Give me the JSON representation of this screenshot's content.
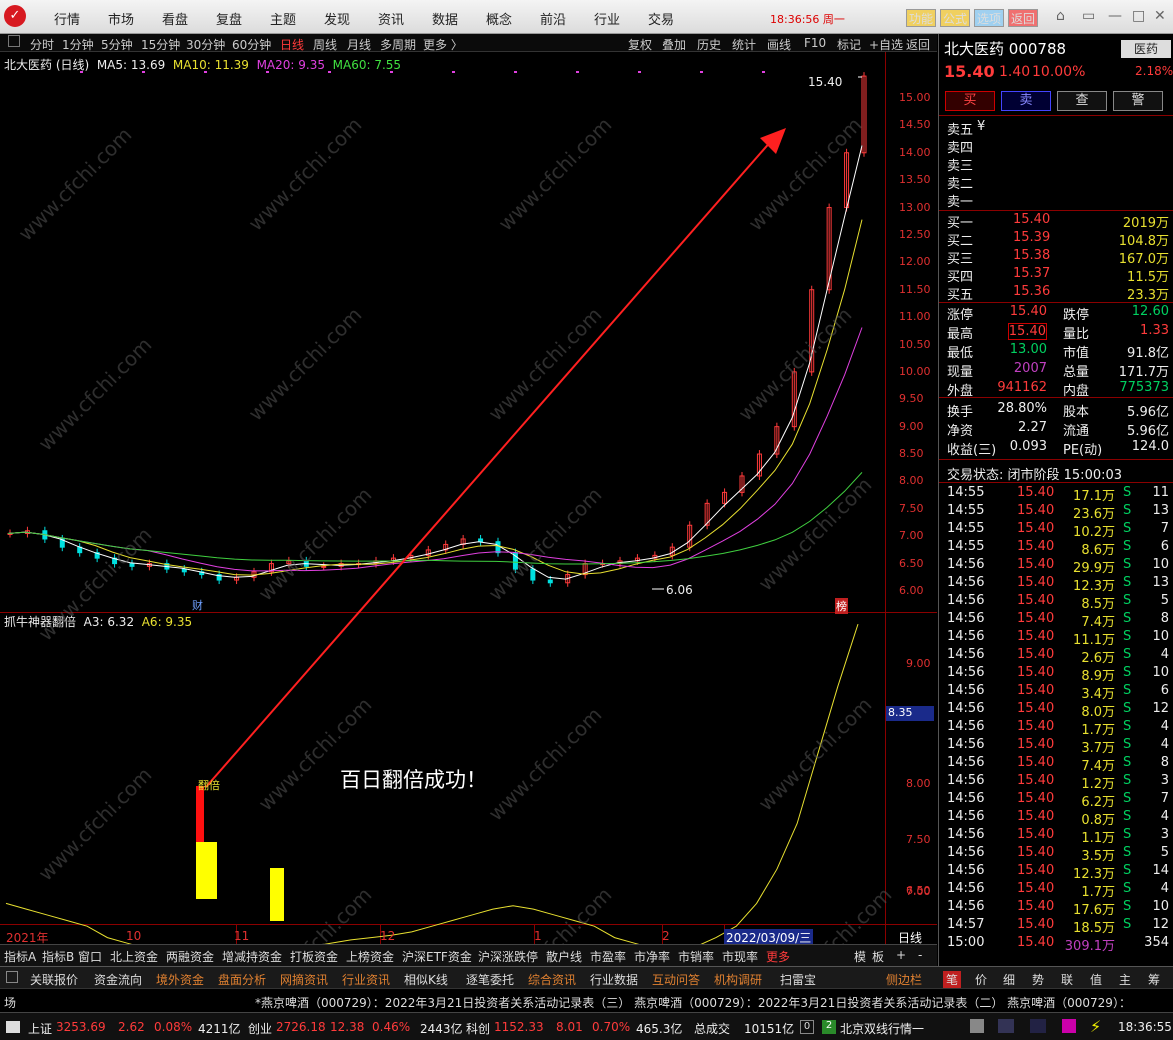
{
  "menu": {
    "items": [
      "行情",
      "市场",
      "看盘",
      "复盘",
      "主题",
      "发现",
      "资讯",
      "数据",
      "概念",
      "前沿",
      "行业",
      "交易"
    ],
    "time": "18:36:56",
    "weekday": "周一",
    "buttons": [
      "功能",
      "公式",
      "选项",
      "返回"
    ]
  },
  "period": {
    "items": [
      "分时",
      "1分钟",
      "5分钟",
      "15分钟",
      "30分钟",
      "60分钟",
      "日线",
      "周线",
      "月线",
      "多周期",
      "更多 〉"
    ],
    "active": "日线",
    "tools": [
      "复权",
      "叠加",
      "历史",
      "统计",
      "画线",
      "F10",
      "标记",
      "+自选",
      "返回"
    ]
  },
  "main": {
    "title": "北大医药 (日线)",
    "ma5": "MA5: 13.69",
    "ma10": "MA10: 11.39",
    "ma20": "MA20: 9.35",
    "ma60": "MA60: 7.55",
    "high_label": "15.40",
    "low_label": "6.06",
    "cai": "财",
    "bang": "榜"
  },
  "yaxis": [
    "15.00",
    "14.50",
    "14.00",
    "13.50",
    "13.00",
    "12.50",
    "12.00",
    "11.50",
    "11.00",
    "10.50",
    "10.00",
    "9.50",
    "9.00",
    "8.50",
    "8.00",
    "7.50",
    "7.00",
    "6.50",
    "6.00"
  ],
  "indicator": {
    "title": "抓牛神器翻倍",
    "a3": "A3: 6.32",
    "a6": "A6: 9.35",
    "bar_label": "翻倍",
    "current": "8.35",
    "yaxis": [
      "9.00",
      "8.00",
      "7.50",
      "7.00",
      "6.50"
    ]
  },
  "annotation": "百日翻倍成功！",
  "xaxis": {
    "labels": [
      "2021年",
      "10",
      "11",
      "12",
      "1",
      "2"
    ],
    "cursor_date": "2022/03/09/三",
    "period": "日线"
  },
  "chart_data": {
    "type": "candlestick",
    "stock": "北大医药",
    "code": "000788",
    "low": 6.06,
    "high": 15.4,
    "close": 15.4,
    "ylim": [
      5.8,
      15.4
    ],
    "close_series": [
      7.05,
      7.1,
      6.95,
      6.8,
      6.7,
      6.6,
      6.5,
      6.45,
      6.5,
      6.4,
      6.35,
      6.3,
      6.2,
      6.25,
      6.35,
      6.5,
      6.55,
      6.45,
      6.45,
      6.5,
      6.5,
      6.55,
      6.6,
      6.65,
      6.75,
      6.85,
      6.95,
      6.9,
      6.7,
      6.4,
      6.2,
      6.15,
      6.3,
      6.5,
      6.5,
      6.55,
      6.6,
      6.65,
      6.8,
      7.2,
      7.6,
      7.8,
      8.1,
      8.5,
      9.0,
      10.0,
      11.5,
      13.0,
      14.0,
      15.4
    ]
  },
  "quote": {
    "name": "北大医药",
    "code": "000788",
    "sector": "医药",
    "price": "15.40",
    "change": "1.40",
    "pct": "10.00%",
    "sector_pct": "2.18%",
    "btn_buy": "买",
    "btn_sell": "卖",
    "btn_query": "查",
    "btn_alert": "警",
    "asks": [
      "卖五",
      "卖四",
      "卖三",
      "卖二",
      "卖一"
    ],
    "ask_unit": "¥",
    "bids": [
      {
        "l": "买一",
        "p": "15.40",
        "v": "2019万"
      },
      {
        "l": "买二",
        "p": "15.39",
        "v": "104.8万"
      },
      {
        "l": "买三",
        "p": "15.38",
        "v": "167.0万"
      },
      {
        "l": "买四",
        "p": "15.37",
        "v": "11.5万"
      },
      {
        "l": "买五",
        "p": "15.36",
        "v": "23.3万"
      }
    ],
    "stats": [
      {
        "a": "涨停",
        "av": "15.40",
        "b": "跌停",
        "bv": "12.60"
      },
      {
        "a": "最高",
        "av": "15.40",
        "b": "量比",
        "bv": "1.33"
      },
      {
        "a": "最低",
        "av": "13.00",
        "b": "市值",
        "bv": "91.8亿"
      },
      {
        "a": "现量",
        "av": "2007",
        "b": "总量",
        "bv": "171.7万"
      },
      {
        "a": "外盘",
        "av": "941162",
        "b": "内盘",
        "bv": "775373"
      }
    ],
    "stats2": [
      {
        "a": "换手",
        "av": "28.80%",
        "b": "股本",
        "bv": "5.96亿"
      },
      {
        "a": "净资",
        "av": "2.27",
        "b": "流通",
        "bv": "5.96亿"
      },
      {
        "a": "收益(三)",
        "av": "0.093",
        "b": "PE(动)",
        "bv": "124.0"
      }
    ],
    "state": "交易状态: 闭市阶段 15:00:03"
  },
  "trades": [
    [
      "14:55",
      "15.40",
      "17.1万",
      "S",
      "11"
    ],
    [
      "14:55",
      "15.40",
      "23.6万",
      "S",
      "13"
    ],
    [
      "14:55",
      "15.40",
      "10.2万",
      "S",
      "7"
    ],
    [
      "14:55",
      "15.40",
      "8.6万",
      "S",
      "6"
    ],
    [
      "14:56",
      "15.40",
      "29.9万",
      "S",
      "10"
    ],
    [
      "14:56",
      "15.40",
      "12.3万",
      "S",
      "13"
    ],
    [
      "14:56",
      "15.40",
      "8.5万",
      "S",
      "5"
    ],
    [
      "14:56",
      "15.40",
      "7.4万",
      "S",
      "8"
    ],
    [
      "14:56",
      "15.40",
      "11.1万",
      "S",
      "10"
    ],
    [
      "14:56",
      "15.40",
      "2.6万",
      "S",
      "4"
    ],
    [
      "14:56",
      "15.40",
      "8.9万",
      "S",
      "10"
    ],
    [
      "14:56",
      "15.40",
      "3.4万",
      "S",
      "6"
    ],
    [
      "14:56",
      "15.40",
      "8.0万",
      "S",
      "12"
    ],
    [
      "14:56",
      "15.40",
      "1.7万",
      "S",
      "4"
    ],
    [
      "14:56",
      "15.40",
      "3.7万",
      "S",
      "4"
    ],
    [
      "14:56",
      "15.40",
      "7.4万",
      "S",
      "8"
    ],
    [
      "14:56",
      "15.40",
      "1.2万",
      "S",
      "3"
    ],
    [
      "14:56",
      "15.40",
      "6.2万",
      "S",
      "7"
    ],
    [
      "14:56",
      "15.40",
      "0.8万",
      "S",
      "4"
    ],
    [
      "14:56",
      "15.40",
      "1.1万",
      "S",
      "3"
    ],
    [
      "14:56",
      "15.40",
      "3.5万",
      "S",
      "5"
    ],
    [
      "14:56",
      "15.40",
      "12.3万",
      "S",
      "14"
    ],
    [
      "14:56",
      "15.40",
      "1.7万",
      "S",
      "4"
    ],
    [
      "14:56",
      "15.40",
      "17.6万",
      "S",
      "10"
    ],
    [
      "14:57",
      "15.40",
      "18.5万",
      "S",
      "12"
    ],
    [
      "15:00",
      "15.40",
      "309.1万",
      "",
      "354"
    ]
  ],
  "tabs1": [
    "指标A",
    "指标B",
    "窗口",
    "北上资金",
    "两融资金",
    "增减持资金",
    "打板资金",
    "上榜资金",
    "沪深ETF资金",
    "沪深涨跌停",
    "散户线",
    "市盈率",
    "市净率",
    "市销率",
    "市现率",
    "更多"
  ],
  "tabs1_right": [
    "模",
    "板",
    "+",
    "-"
  ],
  "tabs2": [
    "关联报价",
    "资金流向",
    "境外资金",
    "盘面分析",
    "网摘资讯",
    "行业资讯",
    "相似K线",
    "逐笔委托",
    "综合资讯",
    "行业数据",
    "互动问答",
    "机构调研",
    "扫雷宝"
  ],
  "tabs2_side": "侧边栏",
  "tabs2_right": [
    "笔",
    "价",
    "细",
    "势",
    "联",
    "值",
    "主",
    "筹"
  ],
  "ticker": {
    "left": "场",
    "items": "*燕京啤酒（000729）：2022年3月21日投资者关系活动记录表（三）    燕京啤酒（000729）：2022年3月21日投资者关系活动记录表（二）    燕京啤酒（000729）："
  },
  "status": {
    "sh": "上证",
    "sh_v": "3253.69",
    "sh_c": "2.62",
    "sh_p": "0.08%",
    "sh_a": "4211亿",
    "cy": "创业",
    "cy_v": "2726.18",
    "cy_c": "12.38",
    "cy_p": "0.46%",
    "cy_a": "2443亿",
    "kc": "科创",
    "kc_v": "1152.33",
    "kc_c": "8.01",
    "kc_p": "0.70%",
    "kc_a": "465.3亿",
    "total": "总成交",
    "total_v": "10151亿",
    "n1": "0",
    "n2": "2",
    "region": "北京双线行情一",
    "time": "18:36:55"
  },
  "watermark": "www.cfchi.com"
}
